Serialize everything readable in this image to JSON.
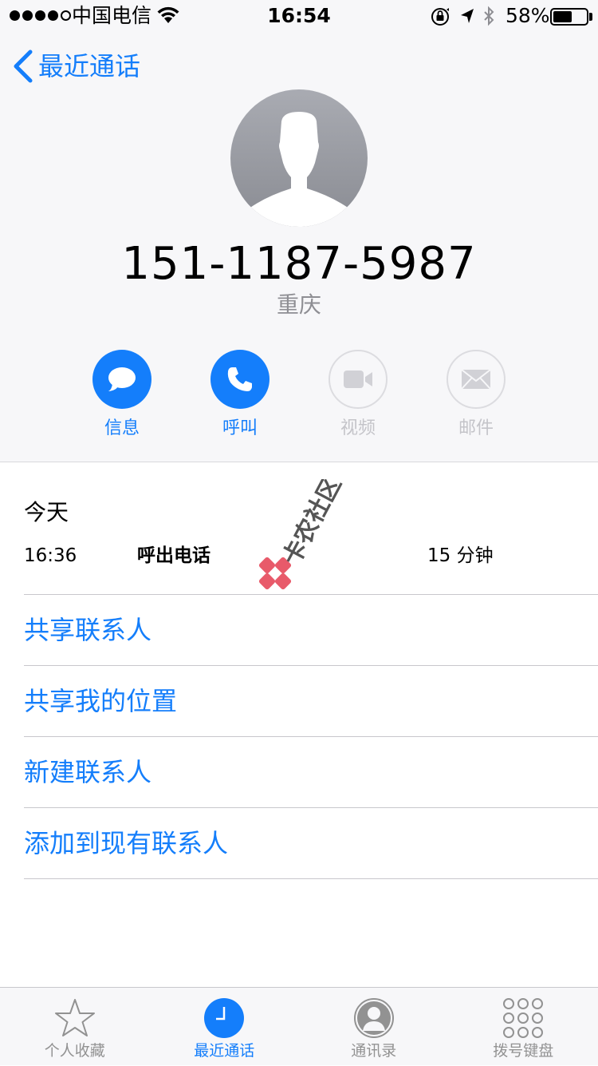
{
  "status_bar": {
    "carrier": "中国电信",
    "time": "16:54",
    "battery_percent_text": "58%",
    "battery_level": 0.58,
    "icons": [
      "orientation-lock-icon",
      "location-arrow-icon",
      "bluetooth-icon"
    ]
  },
  "header": {
    "back_label": "最近通话"
  },
  "contact": {
    "phone_number": "151-1187-5987",
    "location": "重庆"
  },
  "actions": [
    {
      "label": "信息",
      "icon": "message-icon",
      "enabled": true
    },
    {
      "label": "呼叫",
      "icon": "phone-icon",
      "enabled": true
    },
    {
      "label": "视频",
      "icon": "video-icon",
      "enabled": false
    },
    {
      "label": "邮件",
      "icon": "mail-icon",
      "enabled": false
    }
  ],
  "recent_calls": {
    "section_title": "今天",
    "calls": [
      {
        "time": "16:36",
        "type": "呼出电话",
        "duration": "15 分钟"
      }
    ]
  },
  "links": [
    {
      "label": "共享联系人"
    },
    {
      "label": "共享我的位置"
    },
    {
      "label": "新建联系人"
    },
    {
      "label": "添加到现有联系人"
    }
  ],
  "watermark": {
    "text": "卡农社区"
  },
  "tab_bar": {
    "tabs": [
      {
        "label": "个人收藏",
        "icon": "star-icon",
        "active": false
      },
      {
        "label": "最近通话",
        "icon": "clock-icon",
        "active": true
      },
      {
        "label": "通讯录",
        "icon": "contacts-icon",
        "active": false
      },
      {
        "label": "拨号键盘",
        "icon": "keypad-icon",
        "active": false
      }
    ]
  },
  "colors": {
    "accent": "#147efb",
    "secondary_text": "#8e8e93",
    "disabled": "#c4c4c9",
    "header_background": "#f7f7f9"
  }
}
